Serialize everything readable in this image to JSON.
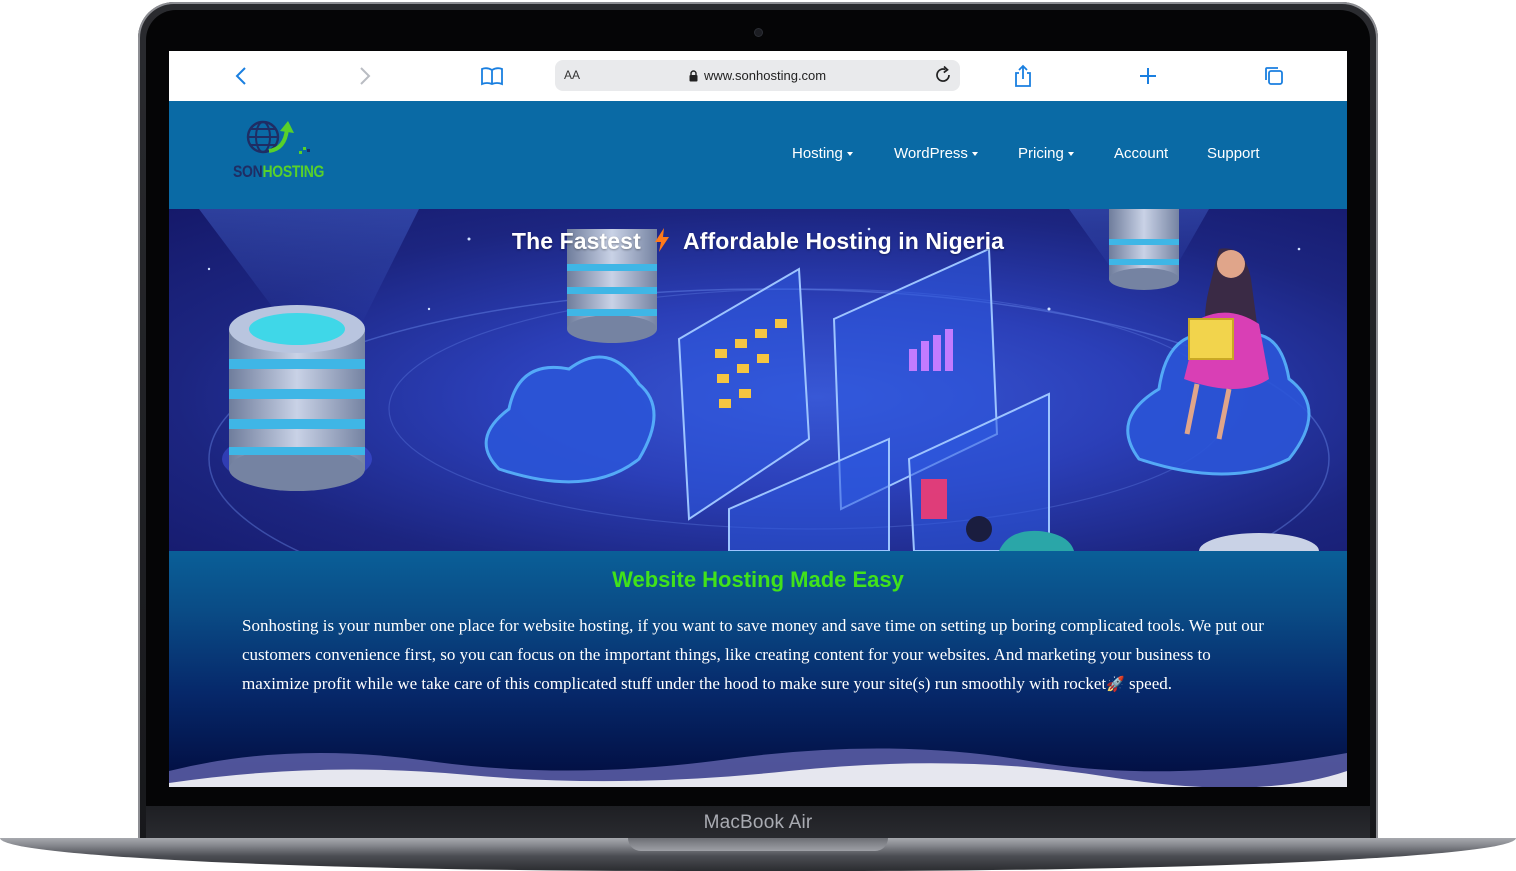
{
  "device": {
    "label": "MacBook Air"
  },
  "browser": {
    "reader_label": "AA",
    "url": "www.sonhosting.com",
    "icons": [
      "back-icon",
      "forward-icon",
      "bookmarks-icon",
      "lock-icon",
      "reload-icon",
      "share-icon",
      "new-tab-icon",
      "tabs-icon"
    ]
  },
  "site": {
    "logo": {
      "part1": "SON",
      "part2": "HOSTING"
    },
    "nav": [
      {
        "label": "Hosting",
        "dropdown": true
      },
      {
        "label": "WordPress",
        "dropdown": true
      },
      {
        "label": "Pricing",
        "dropdown": true
      },
      {
        "label": "Account",
        "dropdown": false
      },
      {
        "label": "Support",
        "dropdown": false
      }
    ],
    "hero": {
      "title_part1": "The Fastest",
      "title_part2": "Affordable Hosting in Nigeria",
      "bolt_icon": "lightning-bolt-icon"
    },
    "section": {
      "heading": "Website Hosting Made Easy",
      "body": "Sonhosting is your number one place for website hosting, if you want to save money and save time on setting up boring complicated tools. We put our customers convenience first, so you can focus on the important things, like creating content for your websites. And marketing your business to maximize profit while we take care of this complicated stuff under the hood to make sure your site(s) run smoothly with rocket",
      "rocket": "🚀",
      "tail": " speed."
    }
  },
  "colors": {
    "nav_bg": "#0a6aa5",
    "accent_green": "#41e21a",
    "link_blue": "#1a7fe0"
  }
}
